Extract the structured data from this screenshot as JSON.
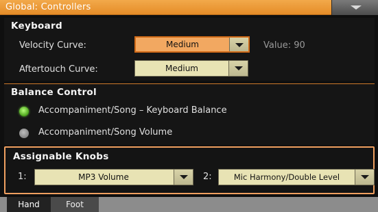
{
  "window": {
    "title": "Global: Controllers"
  },
  "keyboard": {
    "title": "Keyboard",
    "velocity_label": "Velocity Curve:",
    "velocity_value": "Medium",
    "value_text": "Value: 90",
    "aftertouch_label": "Aftertouch Curve:",
    "aftertouch_value": "Medium"
  },
  "balance": {
    "title": "Balance Control",
    "options": [
      {
        "label": "Accompaniment/Song – Keyboard Balance",
        "selected": true
      },
      {
        "label": "Accompaniment/Song Volume",
        "selected": false
      }
    ]
  },
  "knobs": {
    "title": "Assignable Knobs",
    "knob1_label": "1:",
    "knob1_value": "MP3 Volume",
    "knob2_label": "2:",
    "knob2_value": "Mic Harmony/Double Level"
  },
  "tabs": [
    {
      "label": "Hand",
      "active": true
    },
    {
      "label": "Foot",
      "active": false
    }
  ],
  "colors": {
    "accent": "#e58c28",
    "selected_field": "#f2a861",
    "radio_on": "#4aa21a"
  }
}
